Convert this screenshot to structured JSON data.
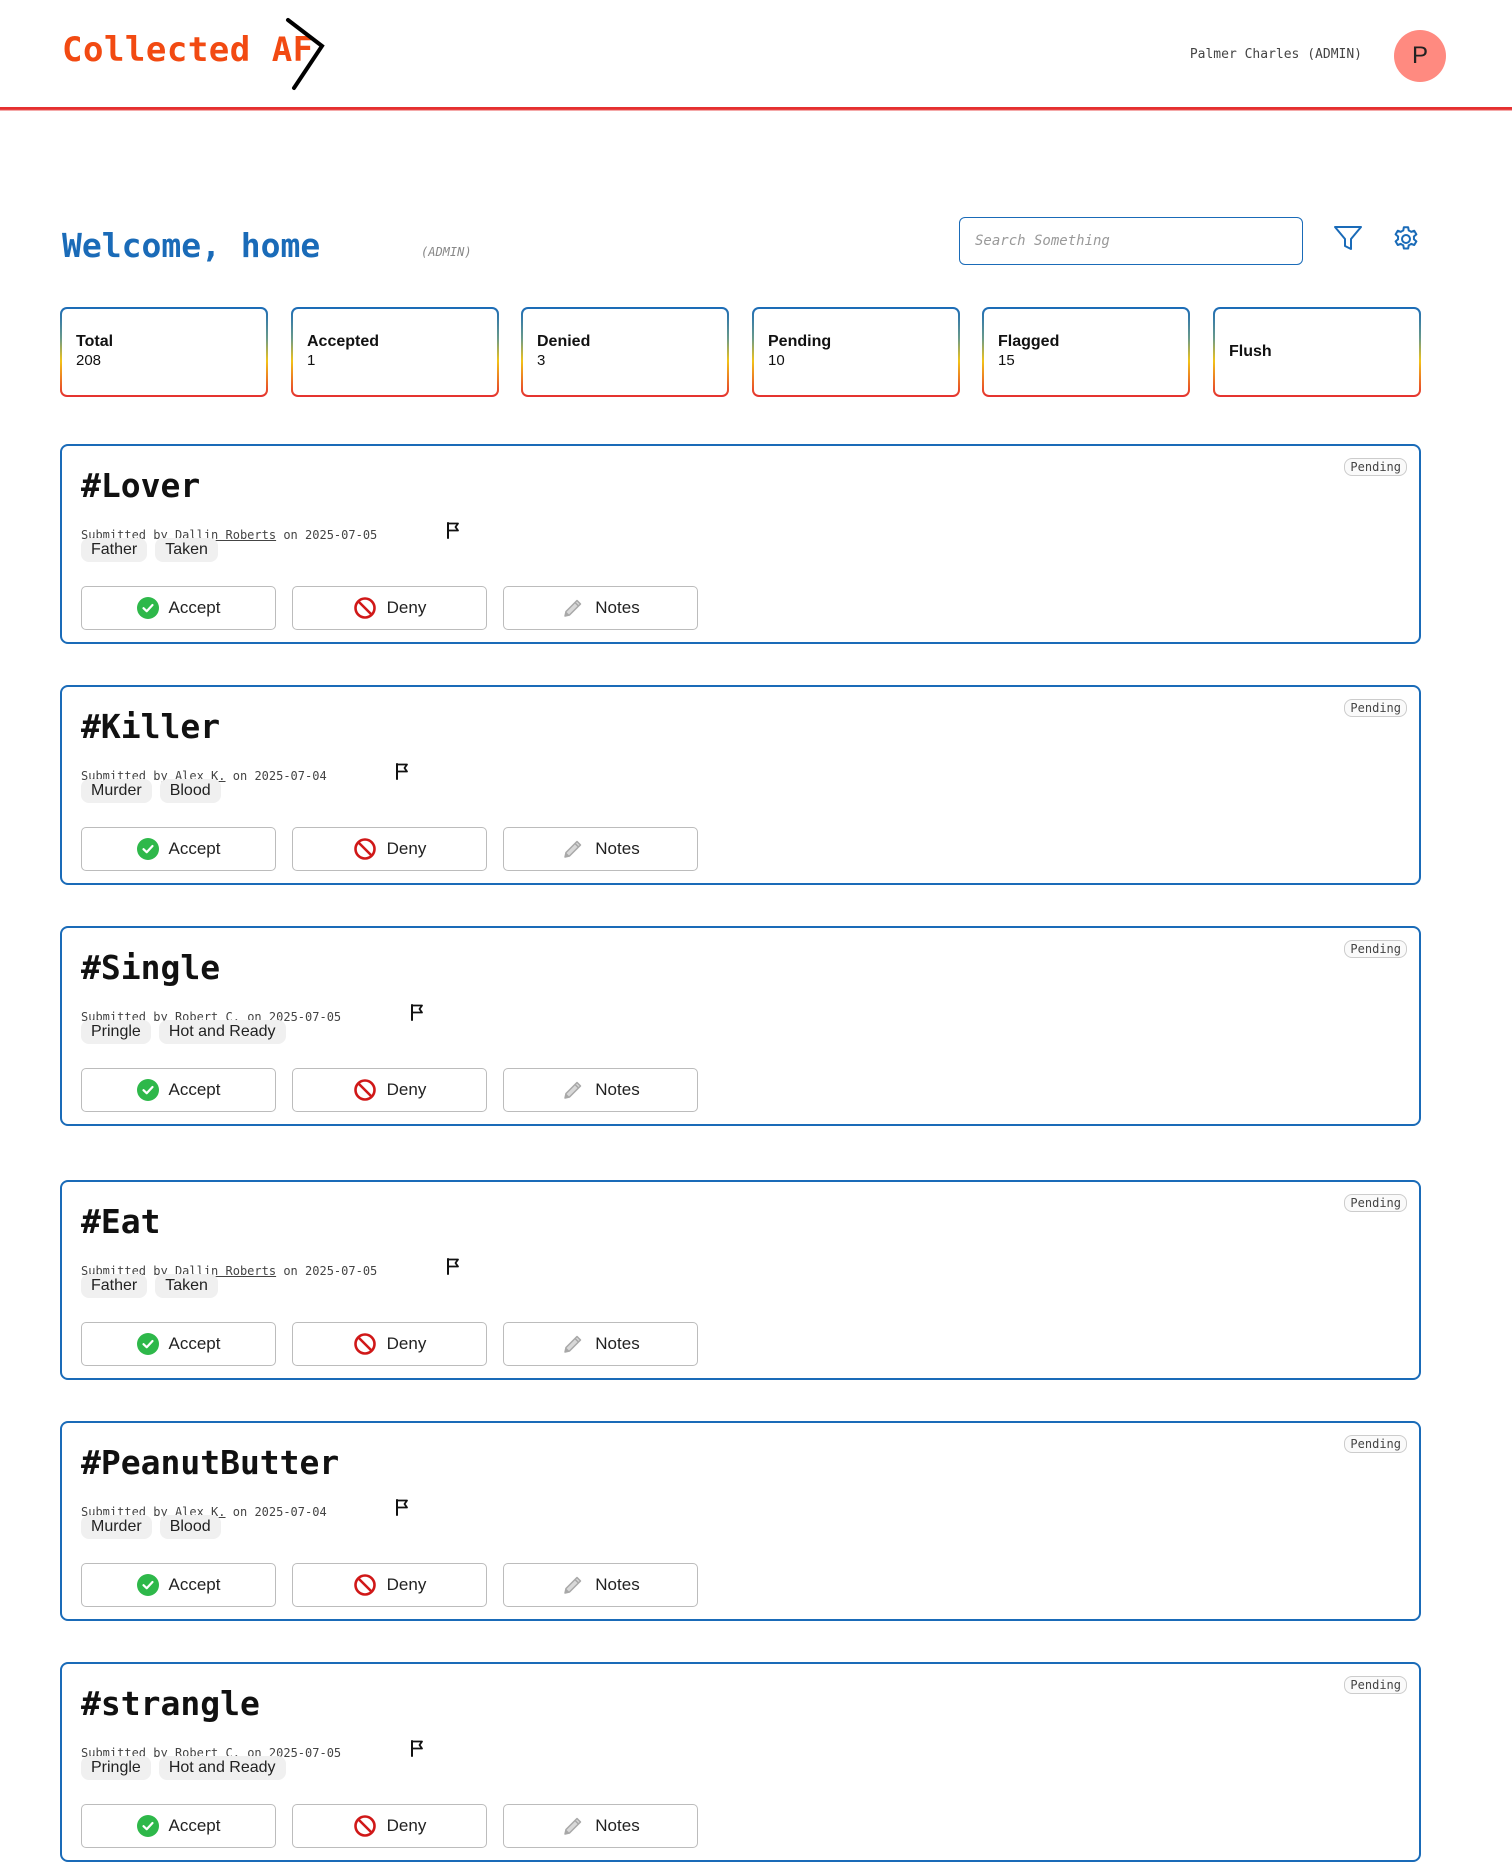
{
  "header": {
    "brand": "Collected AF",
    "user_label": "Palmer Charles (ADMIN)",
    "avatar_initial": "P"
  },
  "welcome": {
    "title": "Welcome, home",
    "role": "(ADMIN)"
  },
  "search": {
    "placeholder": "Search Something",
    "value": ""
  },
  "toolbar": {
    "filter_icon": "filter-icon",
    "settings_icon": "gear-icon"
  },
  "stats": [
    {
      "label": "Total",
      "value": "208"
    },
    {
      "label": "Accepted",
      "value": "1"
    },
    {
      "label": "Denied",
      "value": "3"
    },
    {
      "label": "Pending",
      "value": "10"
    },
    {
      "label": "Flagged",
      "value": "15"
    },
    {
      "label": "Flush",
      "value": ""
    }
  ],
  "labels": {
    "submitted_by": "Submitted by",
    "on": "on",
    "accept": "Accept",
    "deny": "Deny",
    "notes": "Notes"
  },
  "colors": {
    "brand": "#f24a12",
    "primary": "#1a6bb8",
    "accept": "#2eb84a",
    "deny": "#d01818",
    "avatar": "#ff8a80"
  },
  "submissions": [
    {
      "title": "#Lover",
      "user": "Dallin Roberts",
      "date": "2025-07-05",
      "status": "Pending",
      "tags": [
        "Father",
        "Taken"
      ]
    },
    {
      "title": "#Killer",
      "user": "Alex K.",
      "date": "2025-07-04",
      "status": "Pending",
      "tags": [
        "Murder",
        "Blood"
      ]
    },
    {
      "title": "#Single",
      "user": "Robert C.",
      "date": "2025-07-05",
      "status": "Pending",
      "tags": [
        "Pringle",
        "Hot and Ready"
      ]
    },
    {
      "title": "#Eat",
      "user": "Dallin Roberts",
      "date": "2025-07-05",
      "status": "Pending",
      "tags": [
        "Father",
        "Taken"
      ]
    },
    {
      "title": "#PeanutButter",
      "user": "Alex K.",
      "date": "2025-07-04",
      "status": "Pending",
      "tags": [
        "Murder",
        "Blood"
      ]
    },
    {
      "title": "#strangle",
      "user": "Robert C.",
      "date": "2025-07-05",
      "status": "Pending",
      "tags": [
        "Pringle",
        "Hot and Ready"
      ]
    }
  ]
}
